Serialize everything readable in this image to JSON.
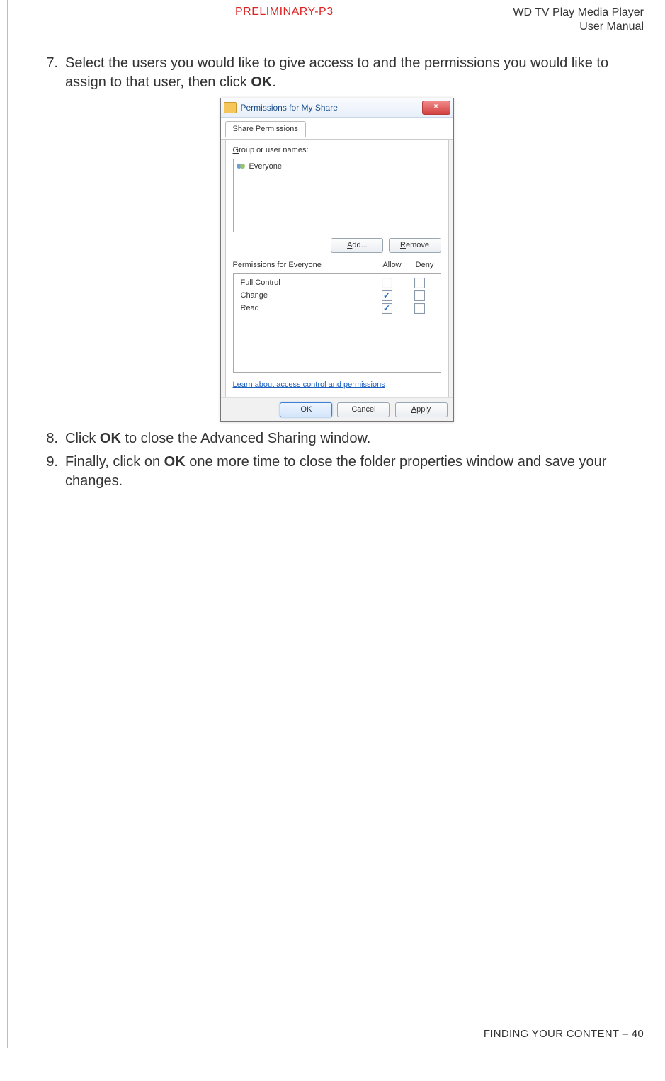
{
  "header": {
    "preliminary": "PRELIMINARY-P3",
    "product_line1": "WD TV Play Media Player",
    "product_line2": "User Manual"
  },
  "steps": {
    "s7_num": "7.",
    "s7_a": "Select the users you would like to give access to and the permissions you would like to assign to that user, then click ",
    "s7_b": "OK",
    "s7_c": ".",
    "s8_num": "8.",
    "s8_a": "Click ",
    "s8_b": "OK",
    "s8_c": " to close the Advanced Sharing window.",
    "s9_num": "9.",
    "s9_a": "Finally, click on ",
    "s9_b": "OK",
    "s9_c": " one more time to close the folder properties window and save your changes."
  },
  "dialog": {
    "title": "Permissions for My Share",
    "close_glyph": "×",
    "tab": "Share Permissions",
    "group_label_pre": "G",
    "group_label_post": "roup or user names:",
    "user_everyone": "Everyone",
    "btn_add_pre": "A",
    "btn_add_post": "dd...",
    "btn_remove_pre": "R",
    "btn_remove_post": "emove",
    "perm_label_pre": "P",
    "perm_label_post": "ermissions for Everyone",
    "col_allow": "Allow",
    "col_deny": "Deny",
    "perm_full": "Full Control",
    "perm_change": "Change",
    "perm_read": "Read",
    "link_text": "Learn about access control and permissions",
    "btn_ok": "OK",
    "btn_cancel": "Cancel",
    "btn_apply_pre": "A",
    "btn_apply_post": "pply",
    "checks": {
      "full_allow": false,
      "full_deny": false,
      "change_allow": true,
      "change_deny": false,
      "read_allow": true,
      "read_deny": false
    }
  },
  "footer": {
    "section": "FINDING YOUR CONTENT – ",
    "page": "40"
  }
}
